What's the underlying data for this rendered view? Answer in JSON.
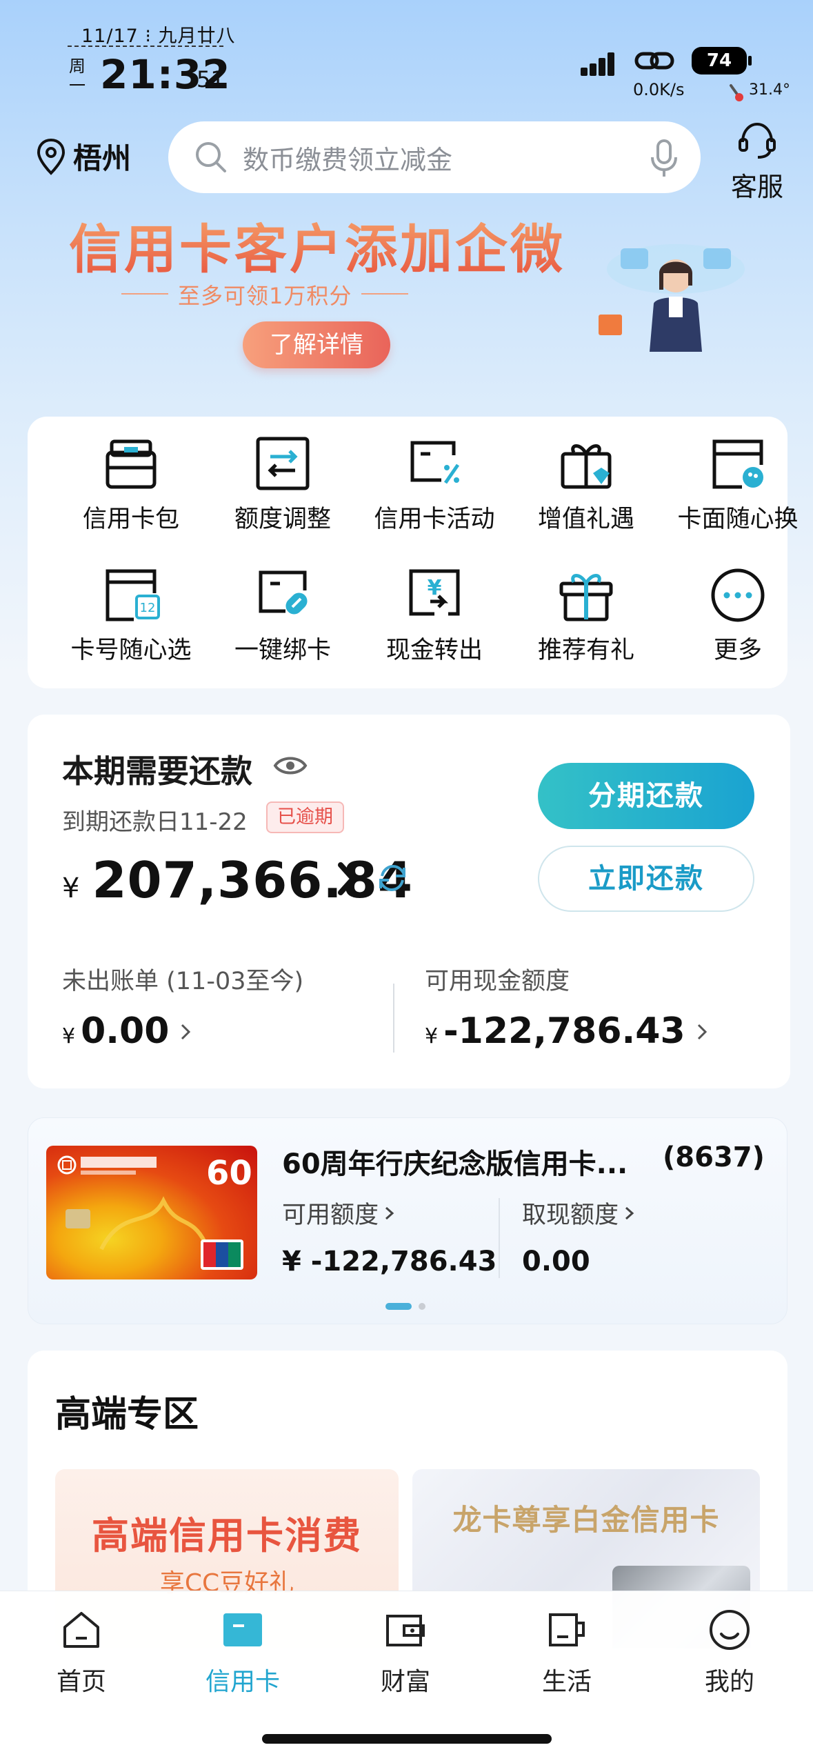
{
  "status_bar": {
    "date": "11/17 ⁝ 九月廿八",
    "weekday": "周一",
    "time": "21:32",
    "seconds": "51",
    "net_speed": "0.0K/s",
    "battery": "74",
    "temperature": "31.4°"
  },
  "header": {
    "location": "梧州",
    "search_placeholder": "数币缴费领立减金",
    "customer_service": "客服"
  },
  "banner": {
    "title": "信用卡客户添加企微",
    "subtitle": "至多可领1万积分",
    "button": "了解详情"
  },
  "quick_grid": [
    {
      "label": "信用卡包",
      "icon": "card-wallet-icon"
    },
    {
      "label": "额度调整",
      "icon": "limit-adjust-icon"
    },
    {
      "label": "信用卡活动",
      "icon": "card-activity-icon"
    },
    {
      "label": "增值礼遇",
      "icon": "gift-box-icon"
    },
    {
      "label": "卡面随心换",
      "icon": "card-face-icon"
    },
    {
      "label": "卡号随心选",
      "icon": "card-number-icon"
    },
    {
      "label": "一键绑卡",
      "icon": "bind-card-icon"
    },
    {
      "label": "现金转出",
      "icon": "cash-out-icon"
    },
    {
      "label": "推荐有礼",
      "icon": "referral-gift-icon"
    },
    {
      "label": "更多",
      "icon": "more-icon"
    }
  ],
  "repayment": {
    "title": "本期需要还款",
    "due_date": "到期还款日11-22",
    "overdue_badge": "已逾期",
    "currency": "¥",
    "amount": "207,366.84",
    "installment_button": "分期还款",
    "pay_button": "立即还款",
    "unbilled_label": "未出账单 (11-03至今)",
    "unbilled_amount": "0.00",
    "cash_limit_label": "可用现金额度",
    "cash_limit_amount": "-122,786.43"
  },
  "card": {
    "name": "60周年行庆纪念版信用卡...",
    "tail": "(8637)",
    "available_label": "可用额度",
    "available_value": "¥  -122,786.43",
    "cash_label": "取现额度",
    "cash_value": "0.00",
    "carousel_page": 1,
    "carousel_total": 2
  },
  "premium": {
    "title": "高端专区",
    "promo1_title": "高端信用卡消费",
    "promo1_sub": "享CC豆好礼",
    "promo2_title": "龙卡尊享白金信用卡"
  },
  "nav": [
    {
      "label": "首页",
      "icon": "home-icon",
      "active": false
    },
    {
      "label": "信用卡",
      "icon": "credit-card-icon",
      "active": true
    },
    {
      "label": "财富",
      "icon": "wallet-icon",
      "active": false
    },
    {
      "label": "生活",
      "icon": "cup-icon",
      "active": false
    },
    {
      "label": "我的",
      "icon": "smile-icon",
      "active": false
    }
  ],
  "colors": {
    "accent": "#21a5cf",
    "banner_title": "#e7533e",
    "overdue": "#e6504a"
  }
}
